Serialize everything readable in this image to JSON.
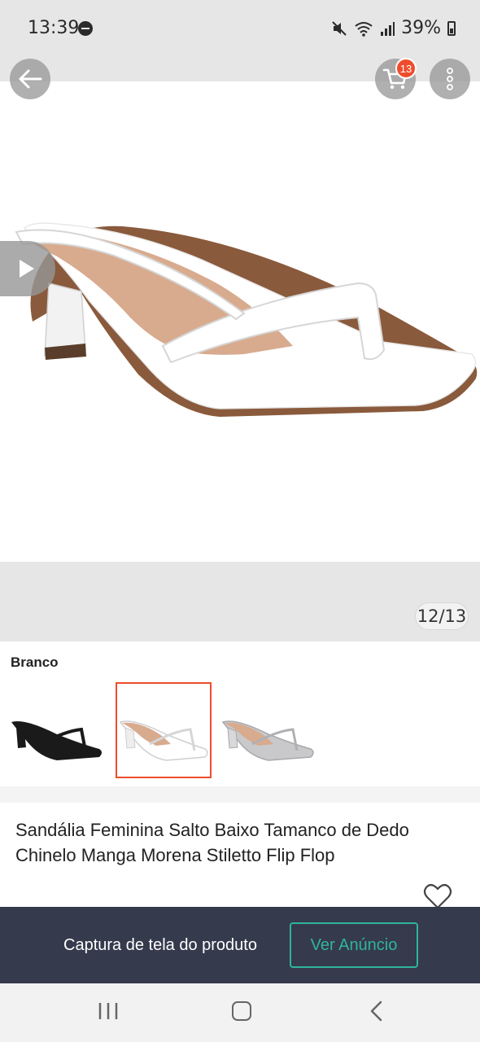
{
  "status_bar": {
    "time": "13:39",
    "battery": "39%",
    "icons": [
      "do-not-disturb-icon",
      "mute-icon",
      "wifi-icon",
      "signal-icon",
      "battery-icon"
    ]
  },
  "header": {
    "cart_badge": "13",
    "icons": [
      "back-arrow-icon",
      "cart-icon",
      "more-vertical-icon"
    ]
  },
  "gallery": {
    "counter": "12/13",
    "current_image": 12,
    "total_images": 13
  },
  "variants": {
    "selected_label": "Branco",
    "items": [
      {
        "color": "#1a1a1a",
        "selected": false
      },
      {
        "color": "#ffffff",
        "selected": true
      },
      {
        "color": "#c9c9cc",
        "selected": false
      }
    ]
  },
  "product": {
    "title": "Sandália Feminina Salto Baixo Tamanco de Dedo Chinelo Manga Morena Stiletto Flip Flop"
  },
  "banner": {
    "text": "Captura de tela do produto",
    "button_label": "Ver Anúncio"
  },
  "colors": {
    "accent": "#ee4d2d",
    "banner_bg": "#363a4d",
    "button_green": "#2fb59a",
    "insole": "#d8ab8e"
  }
}
